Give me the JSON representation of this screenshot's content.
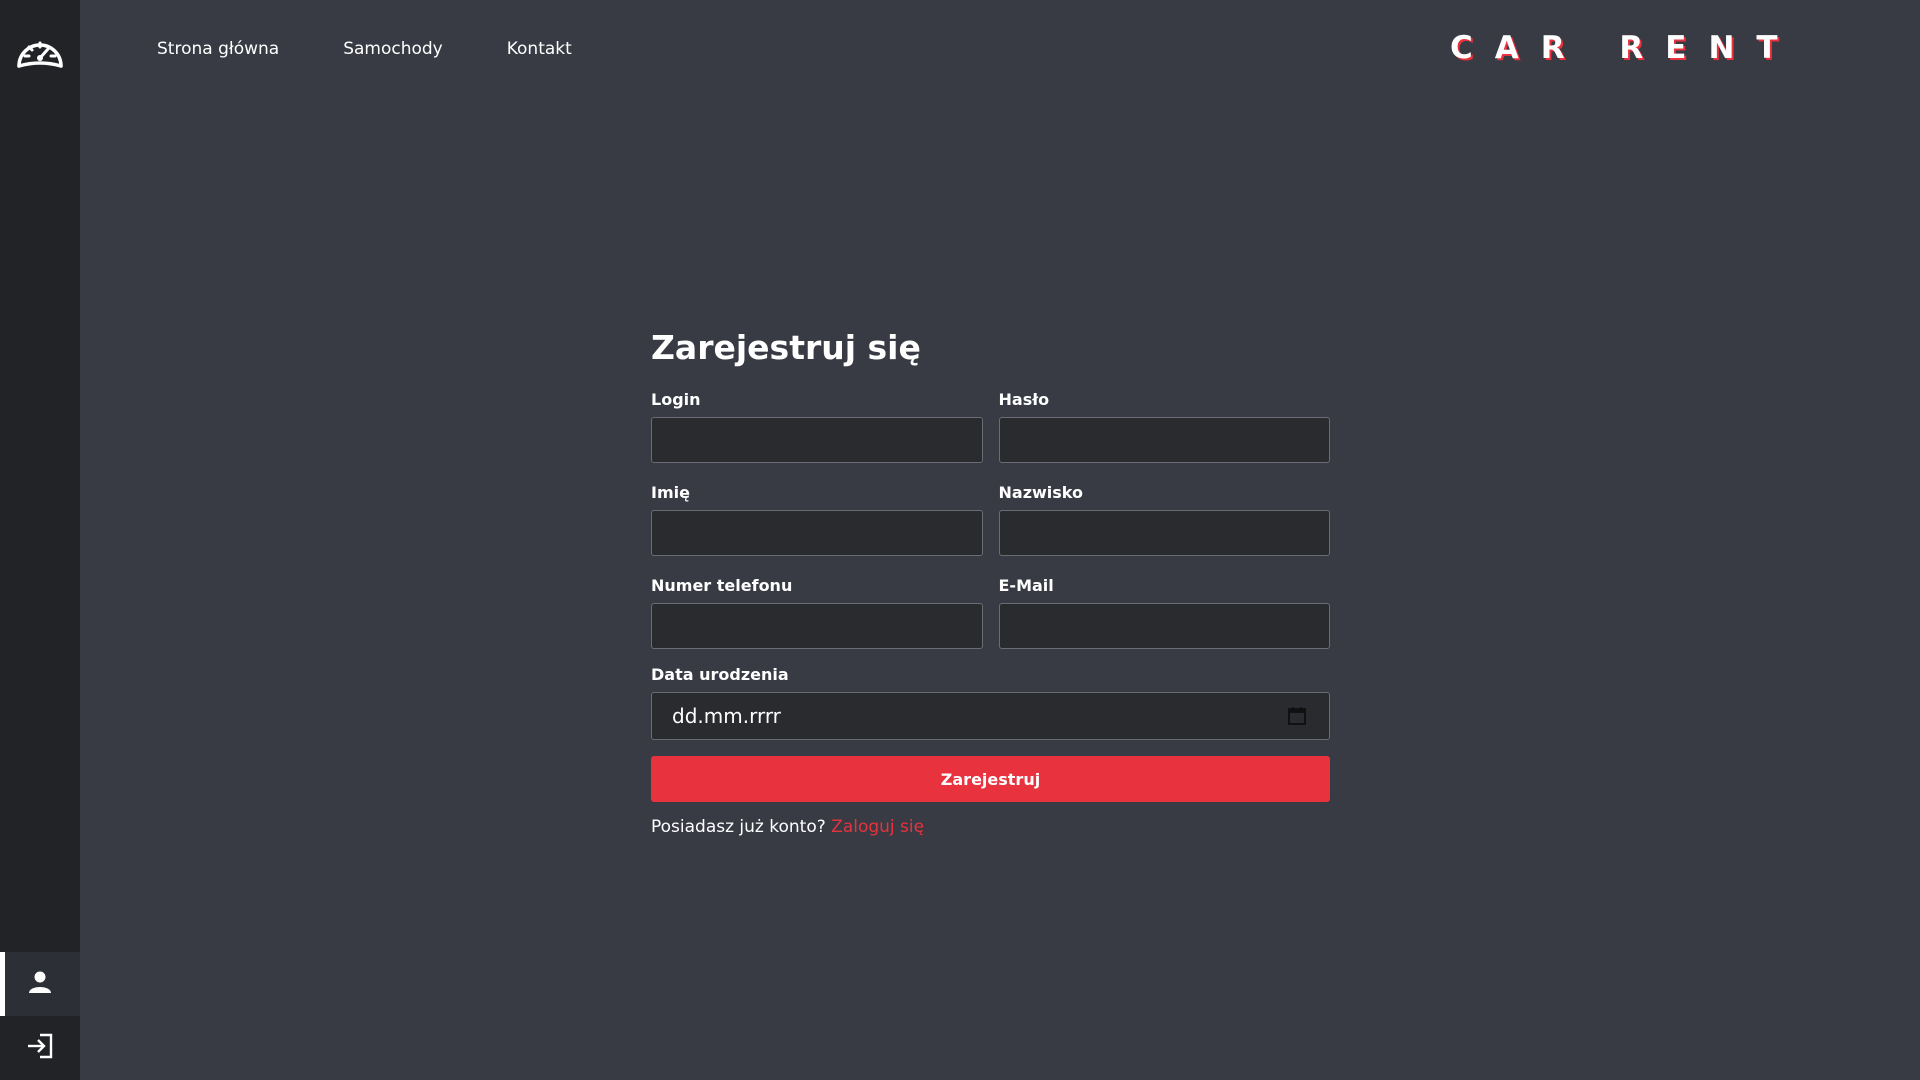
{
  "nav": {
    "home": "Strona główna",
    "cars": "Samochody",
    "contact": "Kontakt"
  },
  "brand": "CAR RENT",
  "form": {
    "title": "Zarejestruj się",
    "login_label": "Login",
    "password_label": "Hasło",
    "first_name_label": "Imię",
    "last_name_label": "Nazwisko",
    "phone_label": "Numer telefonu",
    "email_label": "E-Mail",
    "birthdate_label": "Data urodzenia",
    "birthdate_placeholder": "dd.mm.rrrr",
    "submit_label": "Zarejestruj",
    "have_account_text": "Posiadasz już konto?",
    "login_link": "Zaloguj się"
  },
  "colors": {
    "accent": "#e8323d",
    "background": "#383b44",
    "sidebar": "#222327"
  },
  "icons": {
    "logo": "speedometer-icon",
    "user": "user-icon",
    "login": "login-icon",
    "calendar": "calendar-icon"
  }
}
